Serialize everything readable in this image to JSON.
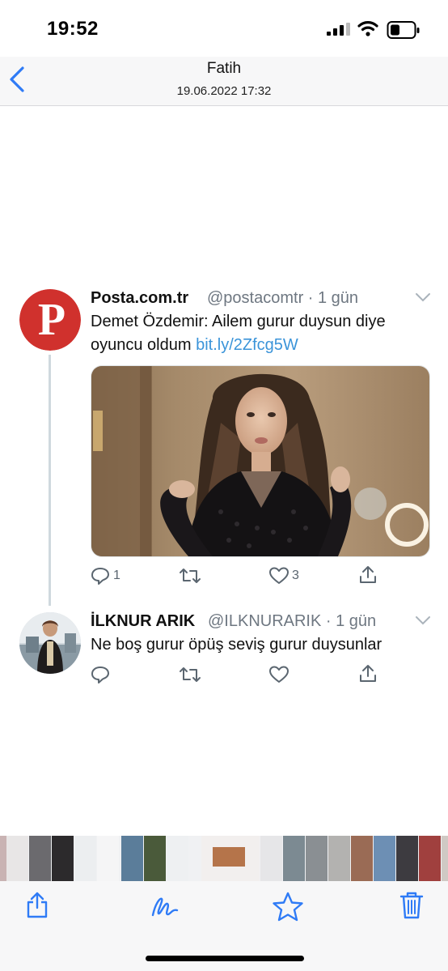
{
  "status_bar": {
    "time": "19:52"
  },
  "nav": {
    "title": "Fatih",
    "subtitle": "19.06.2022 17:32"
  },
  "tweet1": {
    "name": "Posta.com.tr",
    "handle": "@postacomtr · 1 gün",
    "text_line1": "Demet Özdemir: Ailem gurur duysun diye",
    "text_line2": "oyuncu oldum",
    "link": "bit.ly/2Zfcg5W",
    "avatar_letter": "P",
    "replies": "1",
    "likes": "3"
  },
  "tweet2": {
    "name": "İLKNUR ARIK",
    "handle": "@ILKNURARIK · 1 gün",
    "text": "Ne boş gurur öpüş seviş gurur duysunlar"
  },
  "colors": {
    "accent": "#2f7bf6",
    "link": "#3b94d9",
    "posta_red": "#d0312d"
  },
  "icons": [
    "back-chevron-icon",
    "share-icon",
    "markup-icon",
    "star-icon",
    "trash-icon",
    "reply-icon",
    "retweet-icon",
    "like-icon",
    "tweet-share-icon"
  ]
}
